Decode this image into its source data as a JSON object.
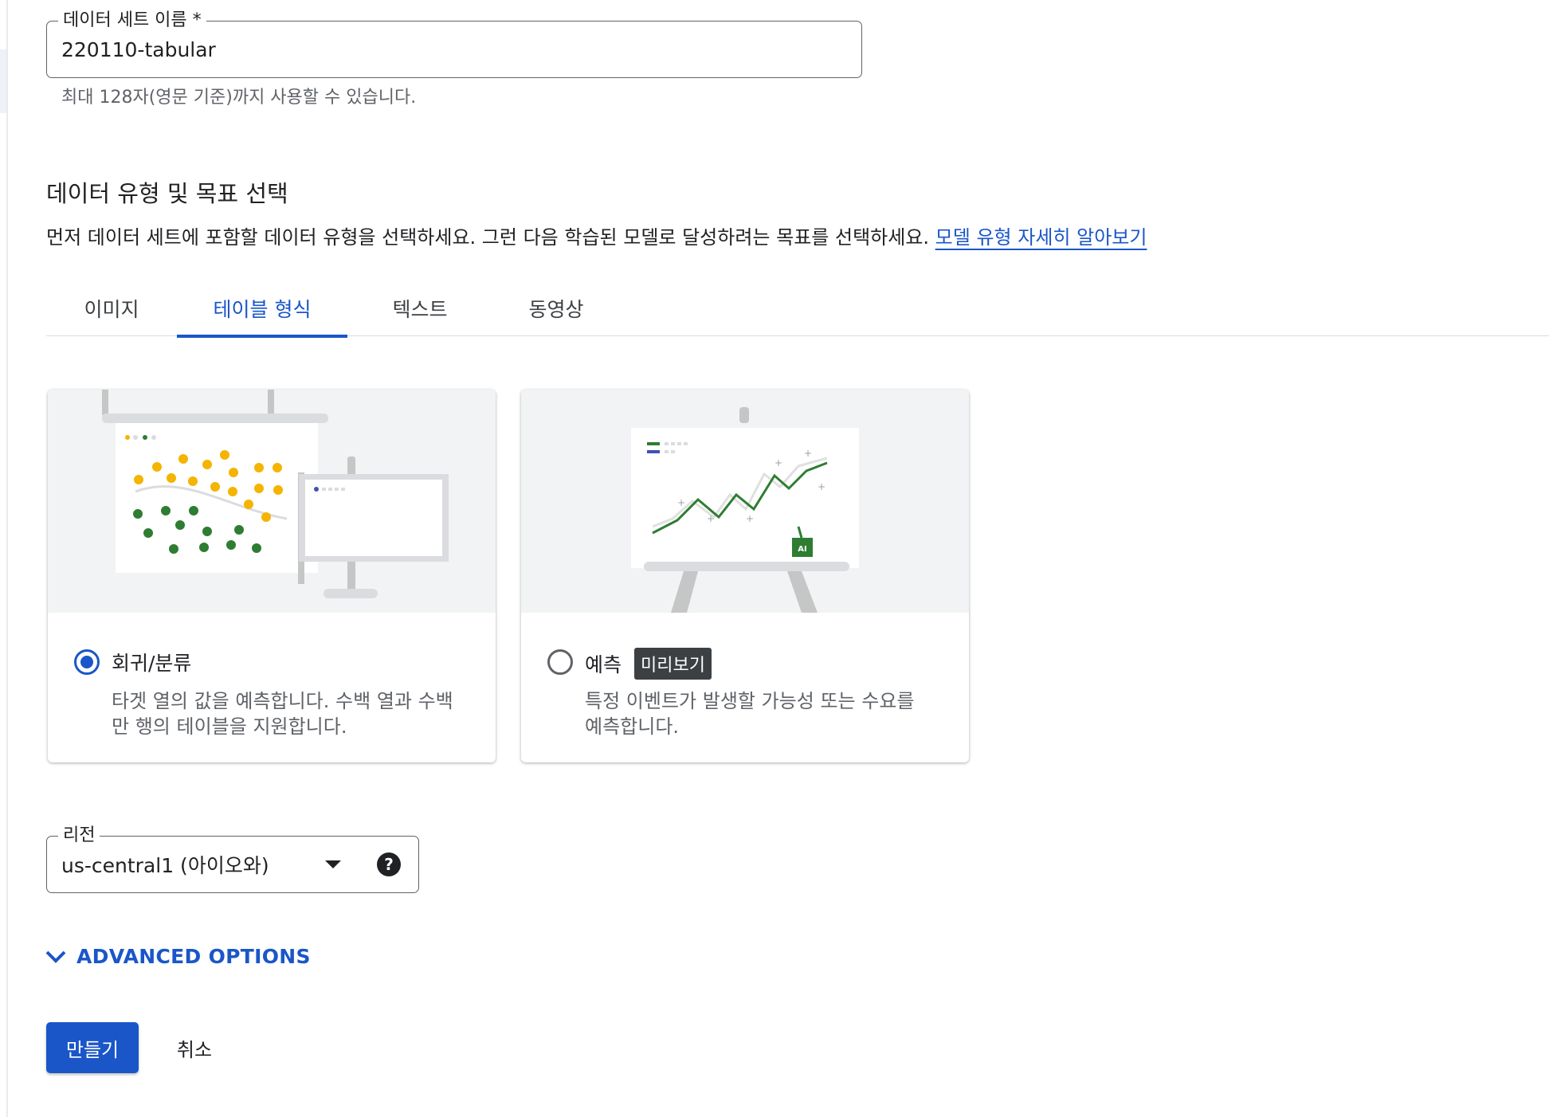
{
  "dataset_name": {
    "label": "데이터 세트 이름 *",
    "value": "220110-tabular",
    "helper": "최대 128자(영문 기준)까지 사용할 수 있습니다."
  },
  "section": {
    "title": "데이터 유형 및 목표 선택",
    "description": "먼저 데이터 세트에 포함할 데이터 유형을 선택하세요. 그런 다음 학습된 모델로 달성하려는 목표를 선택하세요.",
    "learn_more": "모델 유형 자세히 알아보기"
  },
  "tabs": [
    {
      "label": "이미지",
      "active": false
    },
    {
      "label": "테이블 형식",
      "active": true
    },
    {
      "label": "텍스트",
      "active": false
    },
    {
      "label": "동영상",
      "active": false
    }
  ],
  "cards": [
    {
      "title": "회귀/분류",
      "selected": true,
      "description": "타겟 열의 값을 예측합니다. 수백 열과 수백만 행의 테이블을 지원합니다."
    },
    {
      "title": "예측",
      "badge": "미리보기",
      "selected": false,
      "description": "특정 이벤트가 발생할 가능성 또는 수요를 예측합니다."
    }
  ],
  "illustration": {
    "ai_label": "AI"
  },
  "region": {
    "label": "리전",
    "value": "us-central1 (아이오와)"
  },
  "advanced_options": "ADVANCED OPTIONS",
  "buttons": {
    "create": "만들기",
    "cancel": "취소"
  },
  "colors": {
    "accent": "#1a56c8",
    "yellow_dot": "#f4b400",
    "green_dot": "#2e7d32"
  }
}
